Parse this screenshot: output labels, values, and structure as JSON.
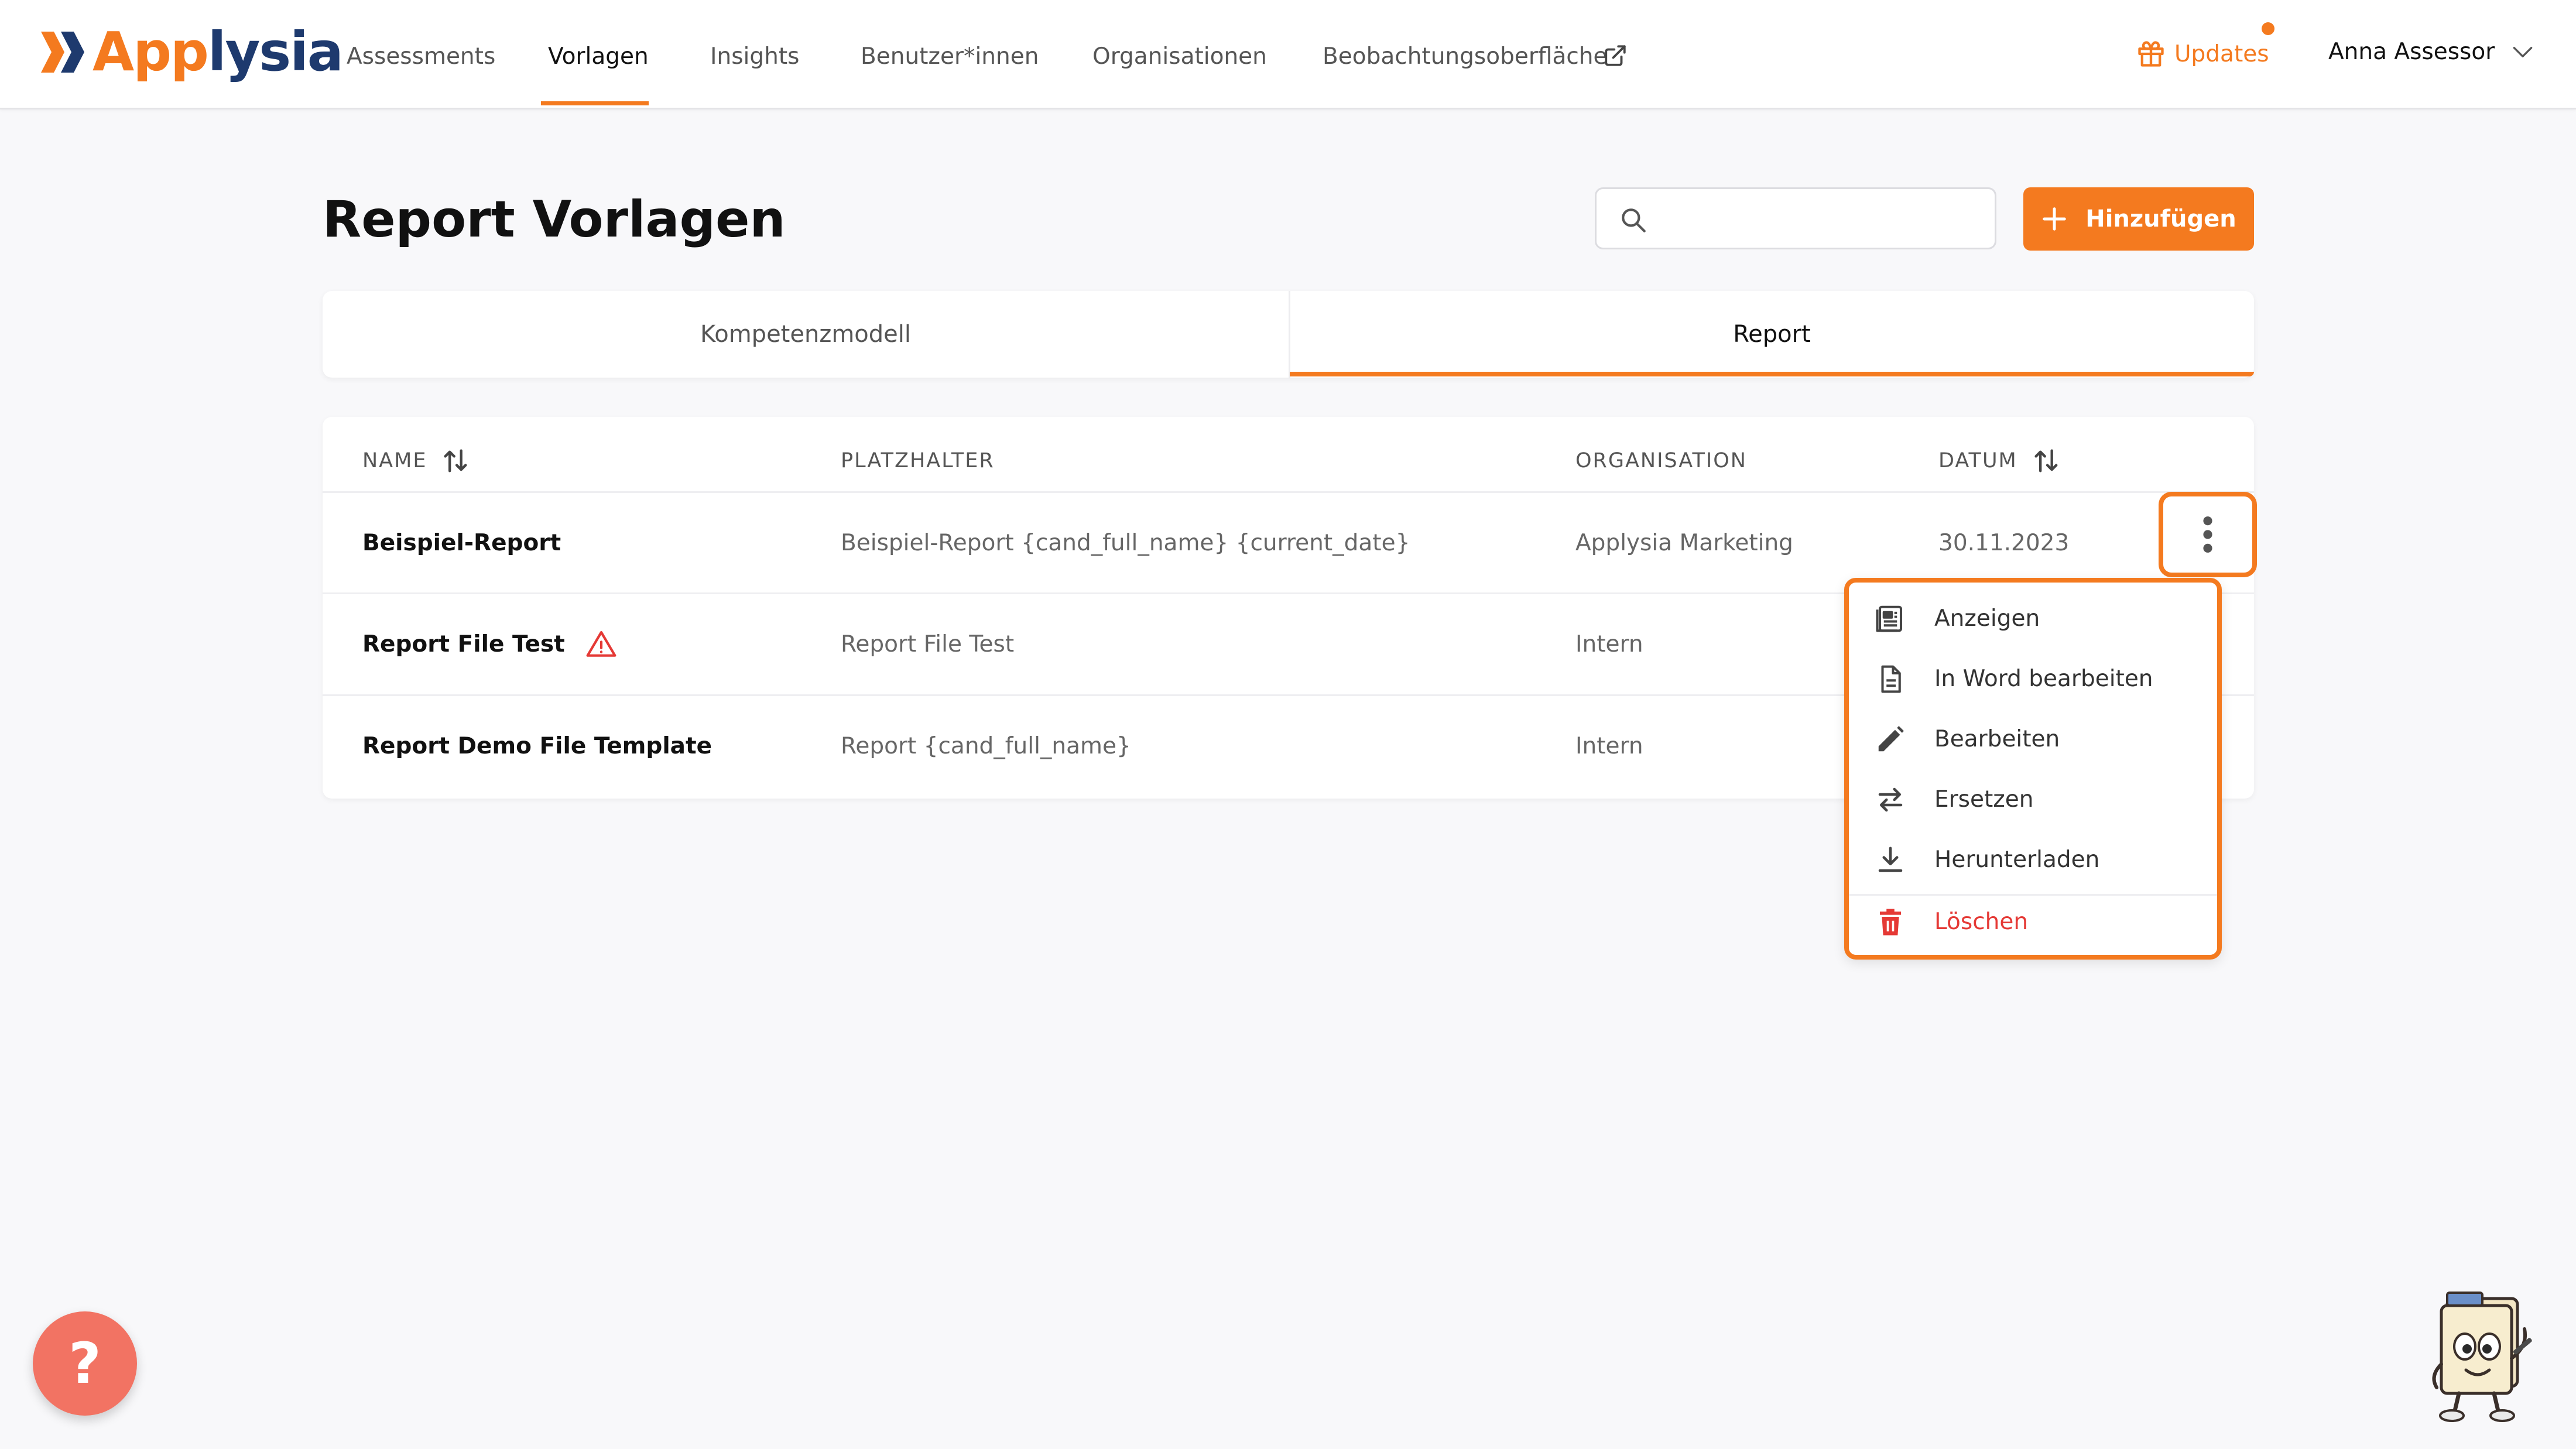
{
  "brand": {
    "logo_text_a": "App",
    "logo_text_b": "lysia",
    "accent_color": "#F47A1F",
    "danger_color": "#E53935"
  },
  "nav": {
    "items": [
      {
        "label": "Assessments"
      },
      {
        "label": "Vorlagen",
        "active": true
      },
      {
        "label": "Insights"
      },
      {
        "label": "Benutzer*innen"
      },
      {
        "label": "Organisationen"
      },
      {
        "label": "Beobachtungsoberfläche",
        "icon": "external-link-icon"
      }
    ],
    "updates_label": "Updates",
    "user_name": "Anna Assessor"
  },
  "page": {
    "title": "Report Vorlagen",
    "search_value": "",
    "search_placeholder": "",
    "add_button_label": "Hinzufügen"
  },
  "tabs": [
    {
      "label": "Kompetenzmodell",
      "active": false
    },
    {
      "label": "Report",
      "active": true
    }
  ],
  "table": {
    "columns": [
      "NAME",
      "PLATZHALTER",
      "ORGANISATION",
      "DATUM"
    ],
    "rows": [
      {
        "name": "Beispiel-Report",
        "placeholder": "Beispiel-Report {cand_full_name} {current_date}",
        "organisation": "Applysia Marketing",
        "date": "30.11.2023",
        "warning": false
      },
      {
        "name": "Report File Test",
        "placeholder": "Report File Test",
        "organisation": "Intern",
        "date": "",
        "warning": true
      },
      {
        "name": "Report Demo File Template",
        "placeholder": "Report {cand_full_name}",
        "organisation": "Intern",
        "date": "",
        "warning": false
      }
    ]
  },
  "context_menu": {
    "items": [
      {
        "label": "Anzeigen",
        "icon": "view-document-icon"
      },
      {
        "label": "In Word bearbeiten",
        "icon": "word-document-icon"
      },
      {
        "label": "Bearbeiten",
        "icon": "pencil-icon"
      },
      {
        "label": "Ersetzen",
        "icon": "swap-arrows-icon"
      },
      {
        "label": "Herunterladen",
        "icon": "download-icon"
      },
      {
        "label": "Löschen",
        "icon": "trash-icon",
        "danger": true
      }
    ]
  },
  "help": {
    "label": "?"
  }
}
